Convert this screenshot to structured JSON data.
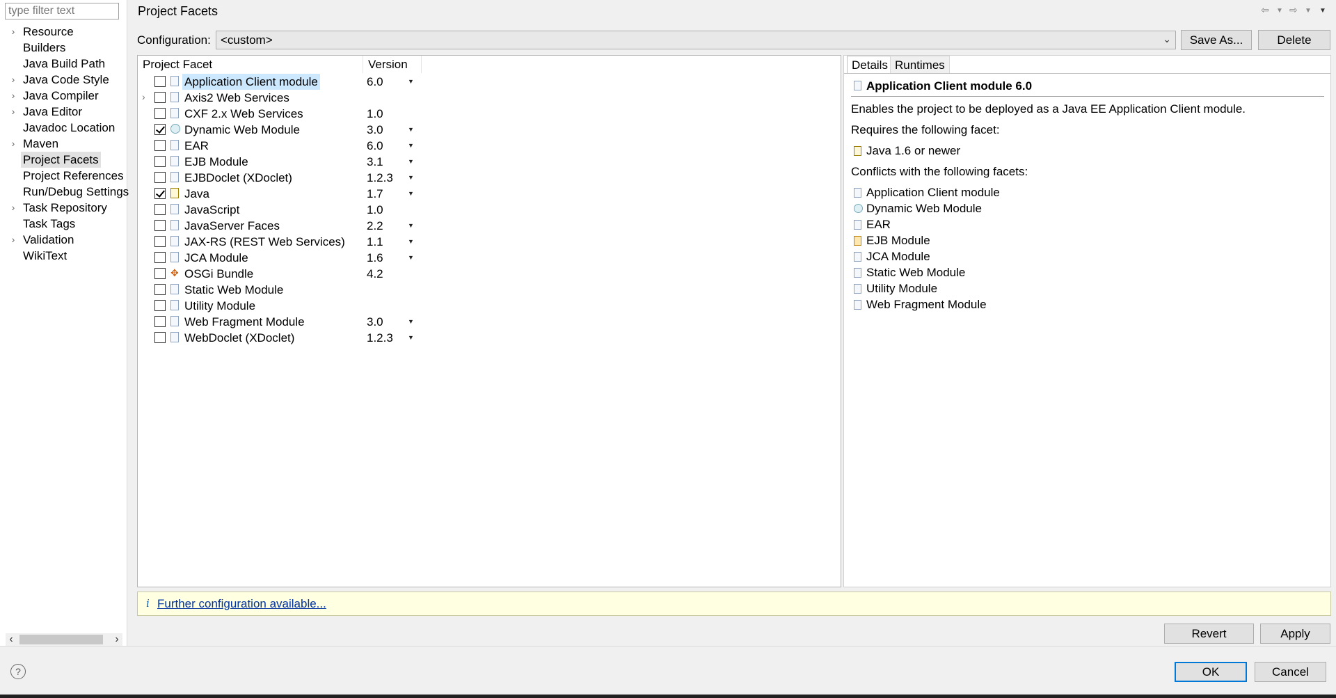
{
  "filter": {
    "placeholder": "type filter text"
  },
  "nav_tree": [
    {
      "label": "Resource",
      "expandable": true
    },
    {
      "label": "Builders",
      "expandable": false
    },
    {
      "label": "Java Build Path",
      "expandable": false
    },
    {
      "label": "Java Code Style",
      "expandable": true
    },
    {
      "label": "Java Compiler",
      "expandable": true
    },
    {
      "label": "Java Editor",
      "expandable": true
    },
    {
      "label": "Javadoc Location",
      "expandable": false
    },
    {
      "label": "Maven",
      "expandable": true
    },
    {
      "label": "Project Facets",
      "expandable": false,
      "selected": true
    },
    {
      "label": "Project References",
      "expandable": false
    },
    {
      "label": "Run/Debug Settings",
      "expandable": false
    },
    {
      "label": "Task Repository",
      "expandable": true
    },
    {
      "label": "Task Tags",
      "expandable": false
    },
    {
      "label": "Validation",
      "expandable": true
    },
    {
      "label": "WikiText",
      "expandable": false
    }
  ],
  "header": {
    "title": "Project Facets"
  },
  "configuration": {
    "label": "Configuration:",
    "value": "<custom>",
    "save_as": "Save As...",
    "delete": "Delete"
  },
  "facets_table": {
    "col_facet": "Project Facet",
    "col_version": "Version",
    "rows": [
      {
        "name": "Application Client module",
        "version": "6.0",
        "checked": false,
        "icon": "page-icon",
        "dropdown": true,
        "selected": true
      },
      {
        "name": "Axis2 Web Services",
        "version": "",
        "checked": false,
        "icon": "page-icon",
        "dropdown": false,
        "expandable": true
      },
      {
        "name": "CXF 2.x Web Services",
        "version": "1.0",
        "checked": false,
        "icon": "page-icon",
        "dropdown": false
      },
      {
        "name": "Dynamic Web Module",
        "version": "3.0",
        "checked": true,
        "icon": "web-module-icon",
        "dropdown": true
      },
      {
        "name": "EAR",
        "version": "6.0",
        "checked": false,
        "icon": "page-icon",
        "dropdown": true
      },
      {
        "name": "EJB Module",
        "version": "3.1",
        "checked": false,
        "icon": "page-icon",
        "dropdown": true
      },
      {
        "name": "EJBDoclet (XDoclet)",
        "version": "1.2.3",
        "checked": false,
        "icon": "page-icon",
        "dropdown": true
      },
      {
        "name": "Java",
        "version": "1.7",
        "checked": true,
        "icon": "java-icon",
        "dropdown": true
      },
      {
        "name": "JavaScript",
        "version": "1.0",
        "checked": false,
        "icon": "page-icon",
        "dropdown": false
      },
      {
        "name": "JavaServer Faces",
        "version": "2.2",
        "checked": false,
        "icon": "page-icon",
        "dropdown": true
      },
      {
        "name": "JAX-RS (REST Web Services)",
        "version": "1.1",
        "checked": false,
        "icon": "page-icon",
        "dropdown": true
      },
      {
        "name": "JCA Module",
        "version": "1.6",
        "checked": false,
        "icon": "page-icon",
        "dropdown": true
      },
      {
        "name": "OSGi Bundle",
        "version": "4.2",
        "checked": false,
        "icon": "osgi-icon",
        "dropdown": false
      },
      {
        "name": "Static Web Module",
        "version": "",
        "checked": false,
        "icon": "page-icon",
        "dropdown": false
      },
      {
        "name": "Utility Module",
        "version": "",
        "checked": false,
        "icon": "page-icon",
        "dropdown": false
      },
      {
        "name": "Web Fragment Module",
        "version": "3.0",
        "checked": false,
        "icon": "page-icon",
        "dropdown": true
      },
      {
        "name": "WebDoclet (XDoclet)",
        "version": "1.2.3",
        "checked": false,
        "icon": "page-icon",
        "dropdown": true
      }
    ]
  },
  "details": {
    "tab_details": "Details",
    "tab_runtimes": "Runtimes",
    "heading": "Application Client module 6.0",
    "description": "Enables the project to be deployed as a Java EE Application Client module.",
    "requires_label": "Requires the following facet:",
    "requires": [
      "Java 1.6 or newer"
    ],
    "conflicts_label": "Conflicts with the following facets:",
    "conflicts": [
      "Application Client module",
      "Dynamic Web Module",
      "EAR",
      "EJB Module",
      "JCA Module",
      "Static Web Module",
      "Utility Module",
      "Web Fragment Module"
    ]
  },
  "infobar": {
    "icon": "i",
    "link": "Further configuration available..."
  },
  "buttons": {
    "revert": "Revert",
    "apply": "Apply",
    "ok": "OK",
    "cancel": "Cancel"
  },
  "help_icon": "?",
  "scroll_arrows": {
    "left": "‹",
    "right": "›"
  }
}
